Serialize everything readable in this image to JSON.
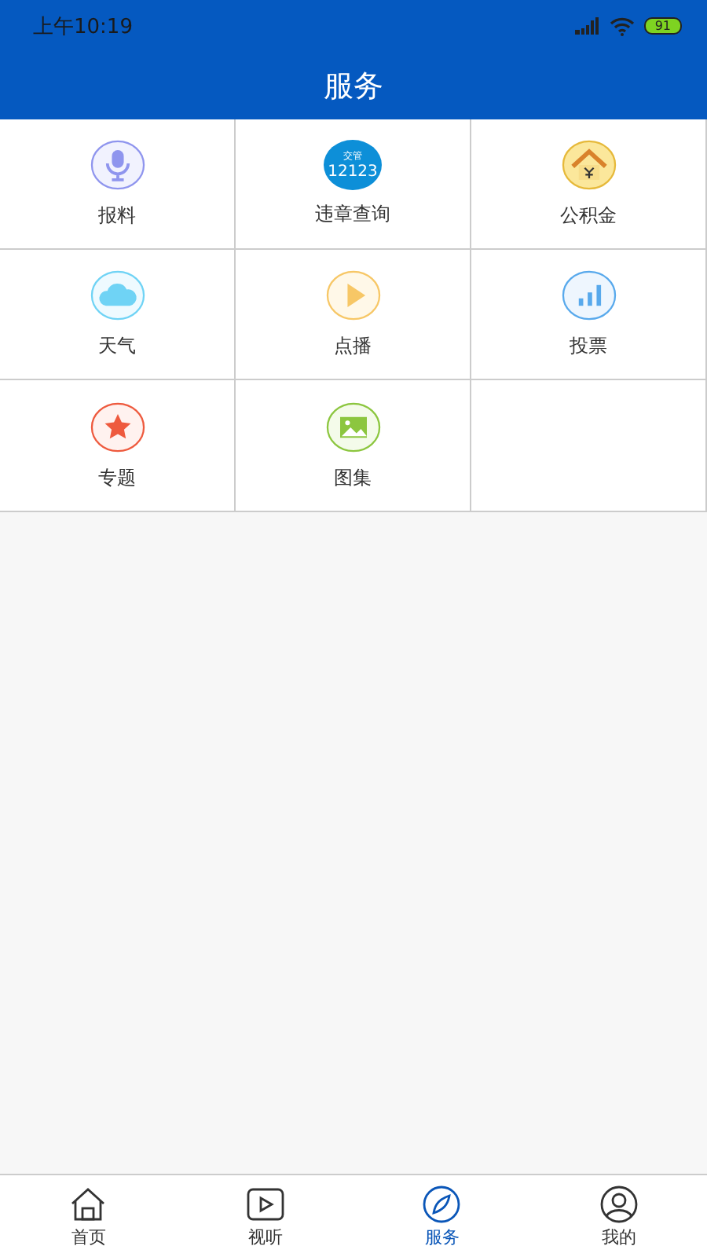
{
  "status_bar": {
    "time": "上午10:19",
    "battery": "91"
  },
  "header": {
    "title": "服务"
  },
  "services": [
    {
      "label": "报料",
      "kind": "mic"
    },
    {
      "label": "违章查询",
      "kind": "logo",
      "logo_lines": [
        "交管",
        "12123"
      ]
    },
    {
      "label": "公积金",
      "kind": "house"
    },
    {
      "label": "天气",
      "kind": "cloud"
    },
    {
      "label": "点播",
      "kind": "play"
    },
    {
      "label": "投票",
      "kind": "bars"
    },
    {
      "label": "专题",
      "kind": "star"
    },
    {
      "label": "图集",
      "kind": "image"
    }
  ],
  "tab_bar": [
    {
      "label": "首页",
      "kind": "home",
      "selected": false
    },
    {
      "label": "视听",
      "kind": "video",
      "selected": false
    },
    {
      "label": "服务",
      "kind": "compass",
      "selected": true
    },
    {
      "label": "我的",
      "kind": "user",
      "selected": false
    }
  ]
}
